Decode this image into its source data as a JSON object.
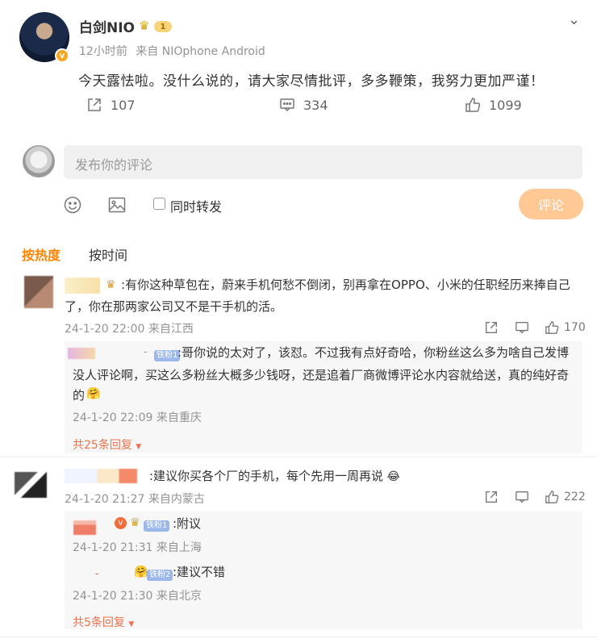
{
  "post": {
    "author": "白剑NIO",
    "level": "1",
    "time": "12小时前",
    "source": "来自 NIOphone Android",
    "content": "今天露怯啦。没什么说的，请大家尽情批评，多多鞭策，我努力更加严谨！",
    "reposts": "107",
    "comments": "334",
    "likes": "1099"
  },
  "composer": {
    "placeholder": "发布你的评论",
    "repost_label": "同时转发",
    "submit_label": "评论"
  },
  "tabs": {
    "hot": "按热度",
    "time": "按时间"
  },
  "comments": [
    {
      "text_line1": ":有你这种草包在，蔚来手机何愁不倒闭，别再拿在OPPO、小米的任职经历来捧自己",
      "text_line2": "了，你在那两家公司又不是干手机的活。",
      "meta": "24-1-20 22:00 来自江西",
      "likes": "170",
      "reply": {
        "badge": "铁粉1",
        "line1": ":哥你说的太对了，该怼。不过我有点好奇哈，你粉丝这么多为啥自己发博",
        "line2": "没人评论啊，买这么多粉丝大概多少钱呀，还是追着厂商微博评论水内容就给送，真的纯好奇",
        "line3": "的",
        "meta": "24-1-20 22:09 来自重庆"
      },
      "more": "共25条回复"
    },
    {
      "text": ":建议你买各个厂的手机，每个先用一周再说",
      "meta": "24-1-20 21:27 来自内蒙古",
      "likes": "222",
      "replies": [
        {
          "badge": "铁粉1",
          "text": ":附议",
          "meta": "24-1-20 21:31 来自上海"
        },
        {
          "badge": "铁粉2",
          "text": ":建议不错",
          "meta": "24-1-20 21:30 来自北京"
        }
      ],
      "more": "共5条回复"
    }
  ],
  "colors": {
    "accent": "#ff8200",
    "link": "#eb7350",
    "submit_bg": "#ffc894"
  }
}
